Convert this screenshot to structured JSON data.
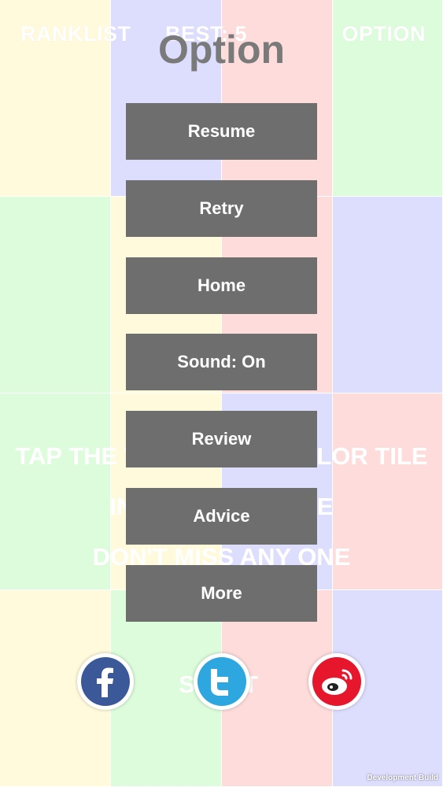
{
  "hud": {
    "ranklist": "RANKLIST",
    "best": "BEST: 5",
    "option": "OPTION"
  },
  "background_text": {
    "line1": "TAP THE TILE OF THE COLOR TILE",
    "line2": "IN THE SEQUENCE",
    "line3": "DON'T MISS ANY ONE",
    "start": "START"
  },
  "dialog": {
    "title": "Option",
    "buttons": [
      "Resume",
      "Retry",
      "Home",
      "Sound: On",
      "Review",
      "Advice",
      "More"
    ]
  },
  "social": {
    "facebook": "facebook-icon",
    "twitter": "twitter-icon",
    "weibo": "weibo-icon"
  },
  "footer": {
    "build_label": "Development Build"
  },
  "colors": {
    "yellow": "#fff6c0",
    "purple": "#c2c1fd",
    "red": "#fdbfc0",
    "green": "#c0fac0",
    "button": "#6e6e6e"
  }
}
